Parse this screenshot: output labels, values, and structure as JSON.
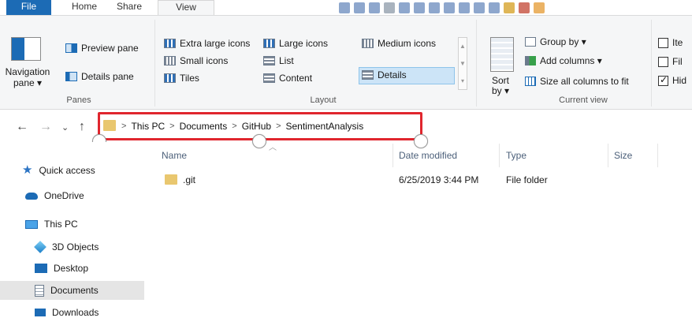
{
  "ribbon_tabs": {
    "file": "File",
    "home": "Home",
    "share": "Share",
    "view": "View"
  },
  "panes_group": {
    "navigation_pane": "Navigation pane ▾",
    "preview_pane": "Preview pane",
    "details_pane": "Details pane",
    "label": "Panes"
  },
  "layout_group": {
    "extra_large": "Extra large icons",
    "large": "Large icons",
    "medium": "Medium icons",
    "small": "Small icons",
    "list": "List",
    "details": "Details",
    "tiles": "Tiles",
    "content": "Content",
    "label": "Layout",
    "selected": "Details"
  },
  "current_view_group": {
    "sort_by": "Sort by ▾",
    "group_by": "Group by ▾",
    "add_columns": "Add columns ▾",
    "size_all_columns": "Size all columns to fit",
    "label": "Current view"
  },
  "show_hide_group": {
    "item_checkboxes": "Ite",
    "file_name_extensions": "Fil",
    "hidden_items": "Hid",
    "item_checkboxes_checked": false,
    "file_name_extensions_checked": false,
    "hidden_items_checked": true
  },
  "address_bar": {
    "crumbs": [
      "This PC",
      "Documents",
      "GitHub",
      "SentimentAnalysis"
    ],
    "separator": ">"
  },
  "nav_pane": {
    "items": [
      {
        "label": "Quick access",
        "icon": "star-icon"
      },
      {
        "label": "OneDrive",
        "icon": "cloud-icon"
      },
      {
        "label": "This PC",
        "icon": "computer-icon"
      },
      {
        "label": "3D Objects",
        "icon": "cube-icon"
      },
      {
        "label": "Desktop",
        "icon": "desktop-icon"
      },
      {
        "label": "Documents",
        "icon": "documents-icon"
      },
      {
        "label": "Downloads",
        "icon": "downloads-icon"
      }
    ],
    "selected": "Documents"
  },
  "file_list": {
    "columns": [
      "Name",
      "Date modified",
      "Type",
      "Size"
    ],
    "rows": [
      {
        "name": ".git",
        "date_modified": "6/25/2019 3:44 PM",
        "type": "File folder",
        "size": ""
      }
    ]
  },
  "colors": {
    "accent": "#1c6bb5",
    "selection": "#cce4f7",
    "highlight_box": "#e0262e",
    "folder": "#e9c76f"
  }
}
